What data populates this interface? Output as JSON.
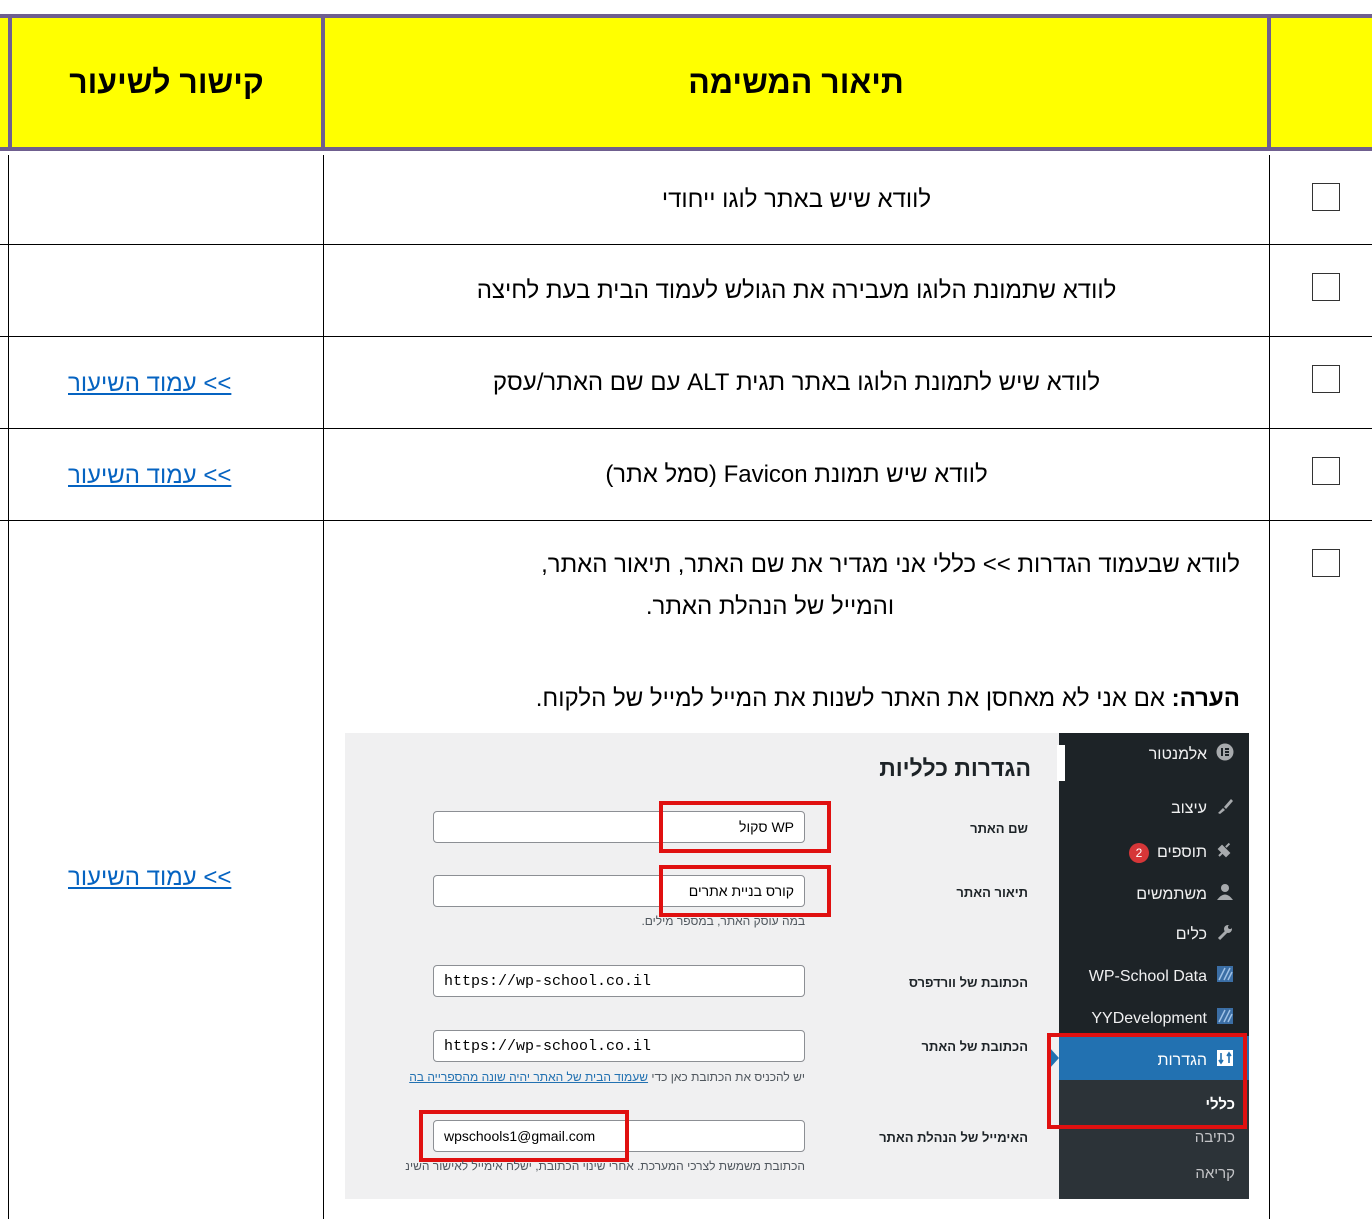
{
  "header": {
    "link_col": "קישור לשיעור",
    "task_col": "תיאור המשימה",
    "check_col": ""
  },
  "rows": [
    {
      "task": "לוודא שיש באתר לוגו ייחודי",
      "link": ""
    },
    {
      "task": "לוודא שתמונת הלוגו מעבירה את הגולש לעמוד הבית בעת לחיצה",
      "link": ""
    },
    {
      "task": "לוודא שיש לתמונת הלוגו באתר תגית ALT עם שם האתר/עסק",
      "link": ">> עמוד השיעור"
    },
    {
      "task": "לוודא שיש תמונת Favicon (סמל אתר)",
      "link": ">> עמוד השיעור"
    },
    {
      "task_line1": "לוודא שבעמוד הגדרות >> כללי אני מגדיר את שם האתר, תיאור האתר,",
      "task_line2": "והמייל של הנהלת האתר.",
      "note_label": "הערה:",
      "note_text": " אם אני לא מאחסן את האתר לשנות את המייל למייל של הלקוח.",
      "link": ">> עמוד השיעור"
    }
  ],
  "screenshot": {
    "sidebar": [
      {
        "label": "אלמנטור",
        "icon": "elementor-icon"
      },
      {
        "label": "עיצוב",
        "icon": "brush-icon"
      },
      {
        "label": "תוספים",
        "icon": "plugin-icon",
        "badge": "2"
      },
      {
        "label": "משתמשים",
        "icon": "users-icon"
      },
      {
        "label": "כלים",
        "icon": "wrench-icon"
      },
      {
        "label": "WP-School Data",
        "icon": "wp-school-icon"
      },
      {
        "label": "YYDevelopment",
        "icon": "yydev-icon"
      },
      {
        "label": "הגדרות",
        "icon": "settings-icon"
      }
    ],
    "submenu": [
      "כללי",
      "כתיבה",
      "קריאה"
    ],
    "title": "הגדרות כלליות",
    "fields": {
      "site_name_label": "שם האתר",
      "site_name_value": "WP סקול",
      "tagline_label": "תיאור האתר",
      "tagline_value": "קורס בניית אתרים",
      "tagline_help": "במה עוסק האתר, במספר מילים.",
      "wp_url_label": "הכתובת של וורדפרס",
      "wp_url_value": "https://wp-school.co.il",
      "site_url_label": "הכתובת של האתר",
      "site_url_value": "https://wp-school.co.il",
      "site_url_help_prefix": "יש להכניס את הכתובת כאן כדי ",
      "site_url_help_link": "שעמוד הבית של האתר יהיה שונה מהספרייה בה",
      "admin_email_label": "האימייל של הנהלת האתר",
      "admin_email_value": "wpschools1@gmail.com",
      "admin_email_help": "הכתובת משמשת לצרכי המערכת. אחרי שינוי הכתובת, ישלח אימייל לאישור השינ"
    }
  },
  "colors": {
    "header_bg": "#ffff00",
    "header_border": "#6f5f8f",
    "link": "#0563c1",
    "highlight": "#e01010"
  }
}
